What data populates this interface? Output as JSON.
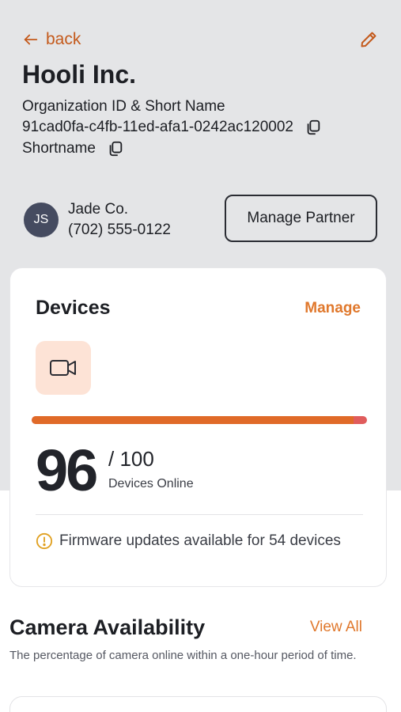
{
  "nav": {
    "back_label": "back",
    "edit_icon": "pencil-icon",
    "accent_color": "#c45a1c"
  },
  "org": {
    "name": "Hooli Inc.",
    "meta_label": "Organization ID & Short Name",
    "id": "91cad0fa-c4fb-11ed-afa1-0242ac120002",
    "shortname": "Shortname",
    "copy_icon": "copy-icon"
  },
  "partner": {
    "initials": "JS",
    "name": "Jade Co.",
    "phone": "(702) 555-0122",
    "avatar_color": "#454b60",
    "manage_label": "Manage Partner"
  },
  "devices": {
    "title": "Devices",
    "manage_label": "Manage",
    "tile_icon": "video-camera-icon",
    "online": "96",
    "total": "/ 100",
    "online_fraction": 0.96,
    "online_label": "Devices Online",
    "firmware_text": "Firmware updates available for 54 devices",
    "warning_icon": "warning-circle-icon",
    "online_color": "#e06a28",
    "offline_color": "#e05c5c"
  },
  "camera_availability": {
    "title": "Camera Availability",
    "view_all_label": "View All",
    "description": "The percentage of camera online within a one-hour period of time."
  }
}
